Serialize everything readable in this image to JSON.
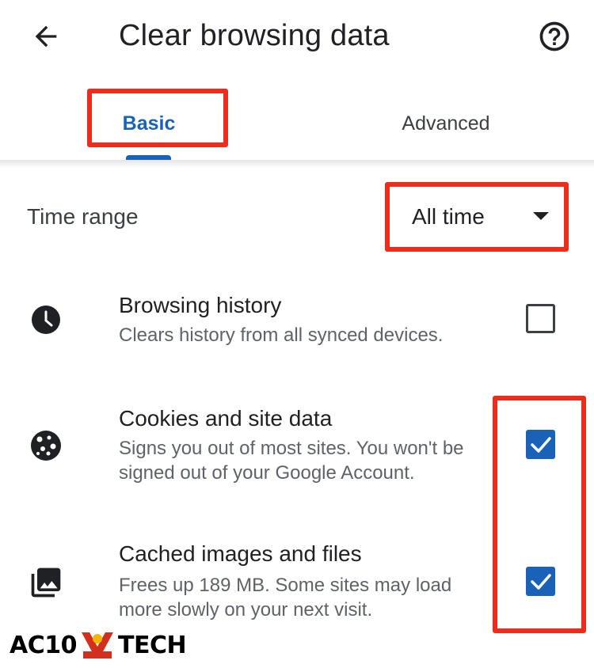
{
  "appbar": {
    "title": "Clear browsing data",
    "back_icon": "arrow-left-icon",
    "help_icon": "help-circle-icon"
  },
  "tabs": [
    {
      "label": "Basic",
      "selected": true
    },
    {
      "label": "Advanced",
      "selected": false
    }
  ],
  "time_range": {
    "label": "Time range",
    "value": "All time"
  },
  "options": [
    {
      "title": "Browsing history",
      "description": "Clears history from all synced devices.",
      "icon": "clock-icon",
      "checked": false
    },
    {
      "title": "Cookies and site data",
      "description": "Signs you out of most sites. You won't be signed out of your Google Account.",
      "icon": "cookie-icon",
      "checked": true
    },
    {
      "title": "Cached images and files",
      "description": "Frees up 189 MB. Some sites may load more slowly on your next visit.",
      "icon": "image-stack-icon",
      "checked": true
    }
  ],
  "watermark": {
    "left_text": "AC10",
    "right_text": "TECH",
    "badge_text": "AC10 Tech"
  },
  "colors": {
    "accent": "#1a62b8",
    "highlight": "#ee2c1b",
    "text_primary": "#202124",
    "text_secondary": "#5f6368"
  }
}
